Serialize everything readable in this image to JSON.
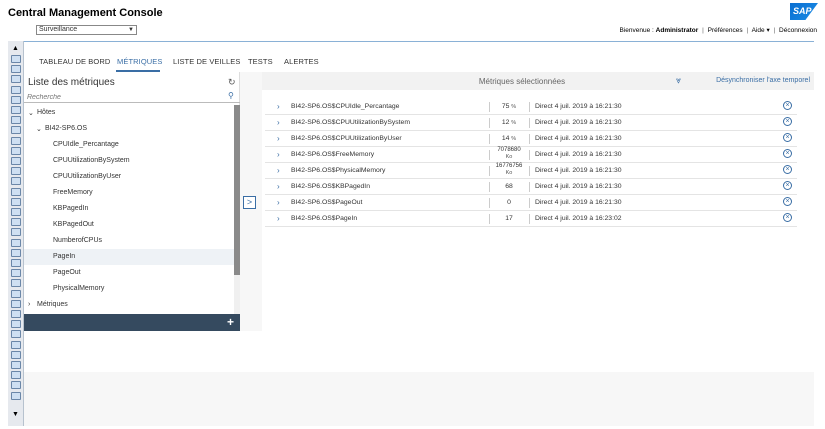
{
  "app": {
    "title": "Central Management Console",
    "logo_text": "SAP"
  },
  "view_select": {
    "value": "Surveillance"
  },
  "userbar": {
    "welcome": "Bienvenue :",
    "user": "Administrator",
    "preferences": "Préférences",
    "help": "Aide",
    "help_arrow": "▾",
    "logout": "Déconnexion"
  },
  "tabs": [
    {
      "label": "TABLEAU DE BORD"
    },
    {
      "label": "MÉTRIQUES",
      "active": true
    },
    {
      "label": "LISTE DE VEILLES"
    },
    {
      "label": "TESTS"
    },
    {
      "label": "ALERTES"
    }
  ],
  "left_panel": {
    "title": "Liste des métriques",
    "search_placeholder": "Recherche",
    "tree": [
      {
        "label": "Hôtes",
        "level": 0,
        "expanded": true
      },
      {
        "label": "BI42-SP6.OS",
        "level": 1,
        "expanded": true
      },
      {
        "label": "CPUIdle_Percantage",
        "level": 2
      },
      {
        "label": "CPUUtilizationBySystem",
        "level": 2
      },
      {
        "label": "CPUUtilizationByUser",
        "level": 2
      },
      {
        "label": "FreeMemory",
        "level": 2
      },
      {
        "label": "KBPagedIn",
        "level": 2
      },
      {
        "label": "KBPagedOut",
        "level": 2
      },
      {
        "label": "NumberofCPUs",
        "level": 2
      },
      {
        "label": "PageIn",
        "level": 2,
        "selected": true
      },
      {
        "label": "PageOut",
        "level": 2
      },
      {
        "label": "PhysicalMemory",
        "level": 2
      },
      {
        "label": "Métriques",
        "level": 0,
        "expanded": false
      }
    ],
    "add_label": "+"
  },
  "right_panel": {
    "title": "Métriques sélectionnées",
    "desync_label": "Désynchroniser l'axe temporel",
    "metrics": [
      {
        "name": "BI42-SP6.OS$CPUIdle_Percantage",
        "value": "75",
        "unit": "%",
        "time": "Direct 4 juil. 2019 à 16:21:30"
      },
      {
        "name": "BI42-SP6.OS$CPUUtilizationBySystem",
        "value": "12",
        "unit": "%",
        "time": "Direct 4 juil. 2019 à 16:21:30"
      },
      {
        "name": "BI42-SP6.OS$CPUUtilizationByUser",
        "value": "14",
        "unit": "%",
        "time": "Direct 4 juil. 2019 à 16:21:30"
      },
      {
        "name": "BI42-SP6.OS$FreeMemory",
        "value": "7078680",
        "unit": "Ko",
        "time": "Direct 4 juil. 2019 à 16:21:30"
      },
      {
        "name": "BI42-SP6.OS$PhysicalMemory",
        "value": "16776756",
        "unit": "Ko",
        "time": "Direct 4 juil. 2019 à 16:21:30"
      },
      {
        "name": "BI42-SP6.OS$KBPagedIn",
        "value": "68",
        "unit": "",
        "time": "Direct 4 juil. 2019 à 16:21:30"
      },
      {
        "name": "BI42-SP6.OS$PageOut",
        "value": "0",
        "unit": "",
        "time": "Direct 4 juil. 2019 à 16:21:30"
      },
      {
        "name": "BI42-SP6.OS$PageIn",
        "value": "17",
        "unit": "",
        "time": "Direct 4 juil. 2019 à 16:23:02"
      }
    ]
  }
}
